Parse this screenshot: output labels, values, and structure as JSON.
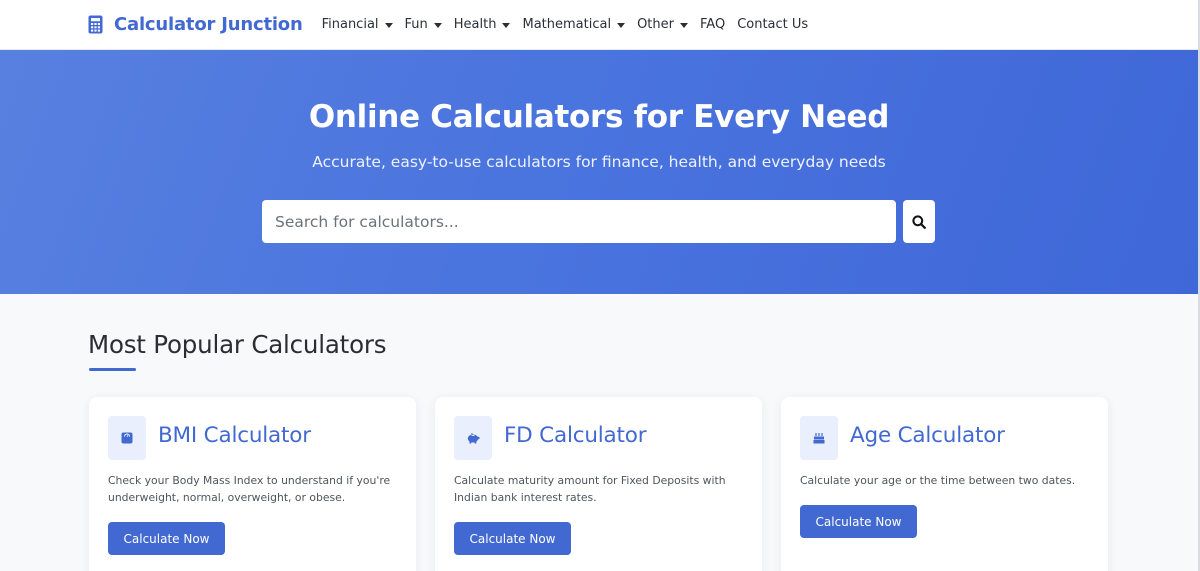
{
  "brand": {
    "name": "Calculator Junction",
    "icon": "calculator-icon"
  },
  "nav": {
    "items": [
      {
        "label": "Financial",
        "dropdown": true
      },
      {
        "label": "Fun",
        "dropdown": true
      },
      {
        "label": "Health",
        "dropdown": true
      },
      {
        "label": "Mathematical",
        "dropdown": true
      },
      {
        "label": "Other",
        "dropdown": true
      },
      {
        "label": "FAQ",
        "dropdown": false
      },
      {
        "label": "Contact Us",
        "dropdown": false
      }
    ]
  },
  "hero": {
    "title": "Online Calculators for Every Need",
    "subtitle": "Accurate, easy-to-use calculators for finance, health, and everyday needs",
    "search": {
      "placeholder": "Search for calculators...",
      "value": "",
      "button_icon": "search-icon"
    }
  },
  "popular": {
    "title": "Most Popular Calculators",
    "cards": [
      {
        "title": "BMI Calculator",
        "icon": "weight-scale-icon",
        "description": "Check your Body Mass Index to understand if you're underweight, normal, overweight, or obese.",
        "button": "Calculate Now"
      },
      {
        "title": "FD Calculator",
        "icon": "piggy-bank-icon",
        "description": "Calculate maturity amount for Fixed Deposits with Indian bank interest rates.",
        "button": "Calculate Now"
      },
      {
        "title": "Age Calculator",
        "icon": "birthday-cake-icon",
        "description": "Calculate your age or the time between two dates.",
        "button": "Calculate Now"
      }
    ]
  },
  "colors": {
    "primary": "#4169d1",
    "hero_gradient_start": "#5880e0",
    "hero_gradient_end": "#3f67d8",
    "icon_box_bg": "#e9effc",
    "page_bg": "#f8f9fb"
  }
}
